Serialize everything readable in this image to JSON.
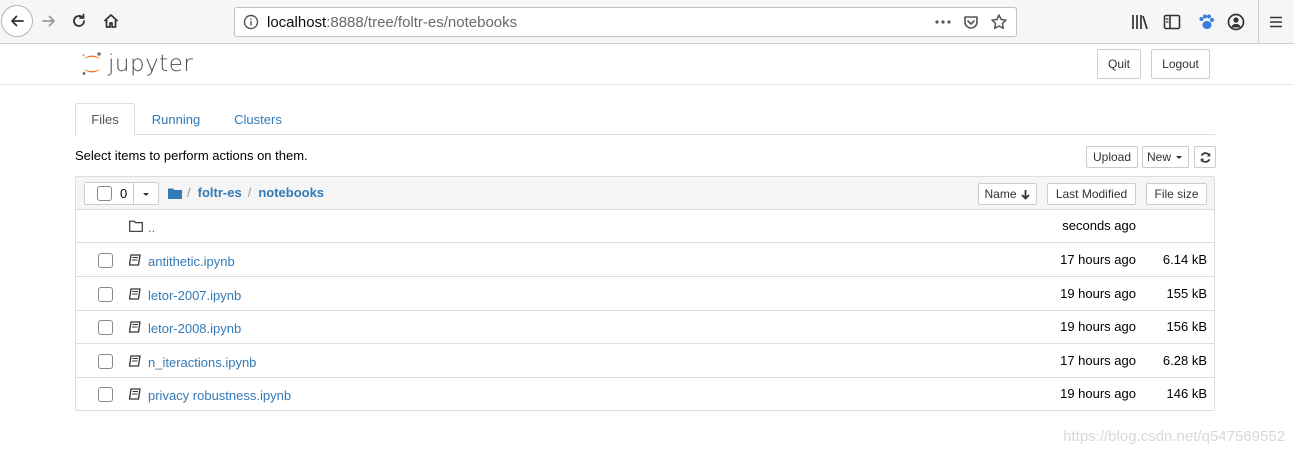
{
  "browser": {
    "url_host": "localhost",
    "url_path": ":8888/tree/foltr-es/notebooks"
  },
  "header": {
    "logo_text": "jupyter",
    "quit_label": "Quit",
    "logout_label": "Logout"
  },
  "tabs": [
    {
      "label": "Files"
    },
    {
      "label": "Running"
    },
    {
      "label": "Clusters"
    }
  ],
  "toolbar": {
    "hint": "Select items to perform actions on them.",
    "upload_label": "Upload",
    "new_label": "New"
  },
  "list": {
    "selected_count": "0",
    "breadcrumb": [
      "foltr-es",
      "notebooks"
    ],
    "sort_name": "Name",
    "sort_modified": "Last Modified",
    "sort_size": "File size",
    "parent": {
      "name": "..",
      "modified": "seconds ago",
      "size": ""
    },
    "rows": [
      {
        "name": "antithetic.ipynb",
        "modified": "17 hours ago",
        "size": "6.14 kB"
      },
      {
        "name": "letor-2007.ipynb",
        "modified": "19 hours ago",
        "size": "155 kB"
      },
      {
        "name": "letor-2008.ipynb",
        "modified": "19 hours ago",
        "size": "156 kB"
      },
      {
        "name": "n_iteractions.ipynb",
        "modified": "17 hours ago",
        "size": "6.28 kB"
      },
      {
        "name": "privacy robustness.ipynb",
        "modified": "19 hours ago",
        "size": "146 kB"
      }
    ]
  },
  "watermark": "https://blog.csdn.net/q547569552",
  "colors": {
    "link": "#337ab7",
    "logo_orange": "#f37726",
    "ext_blue": "#3b7ddd"
  }
}
